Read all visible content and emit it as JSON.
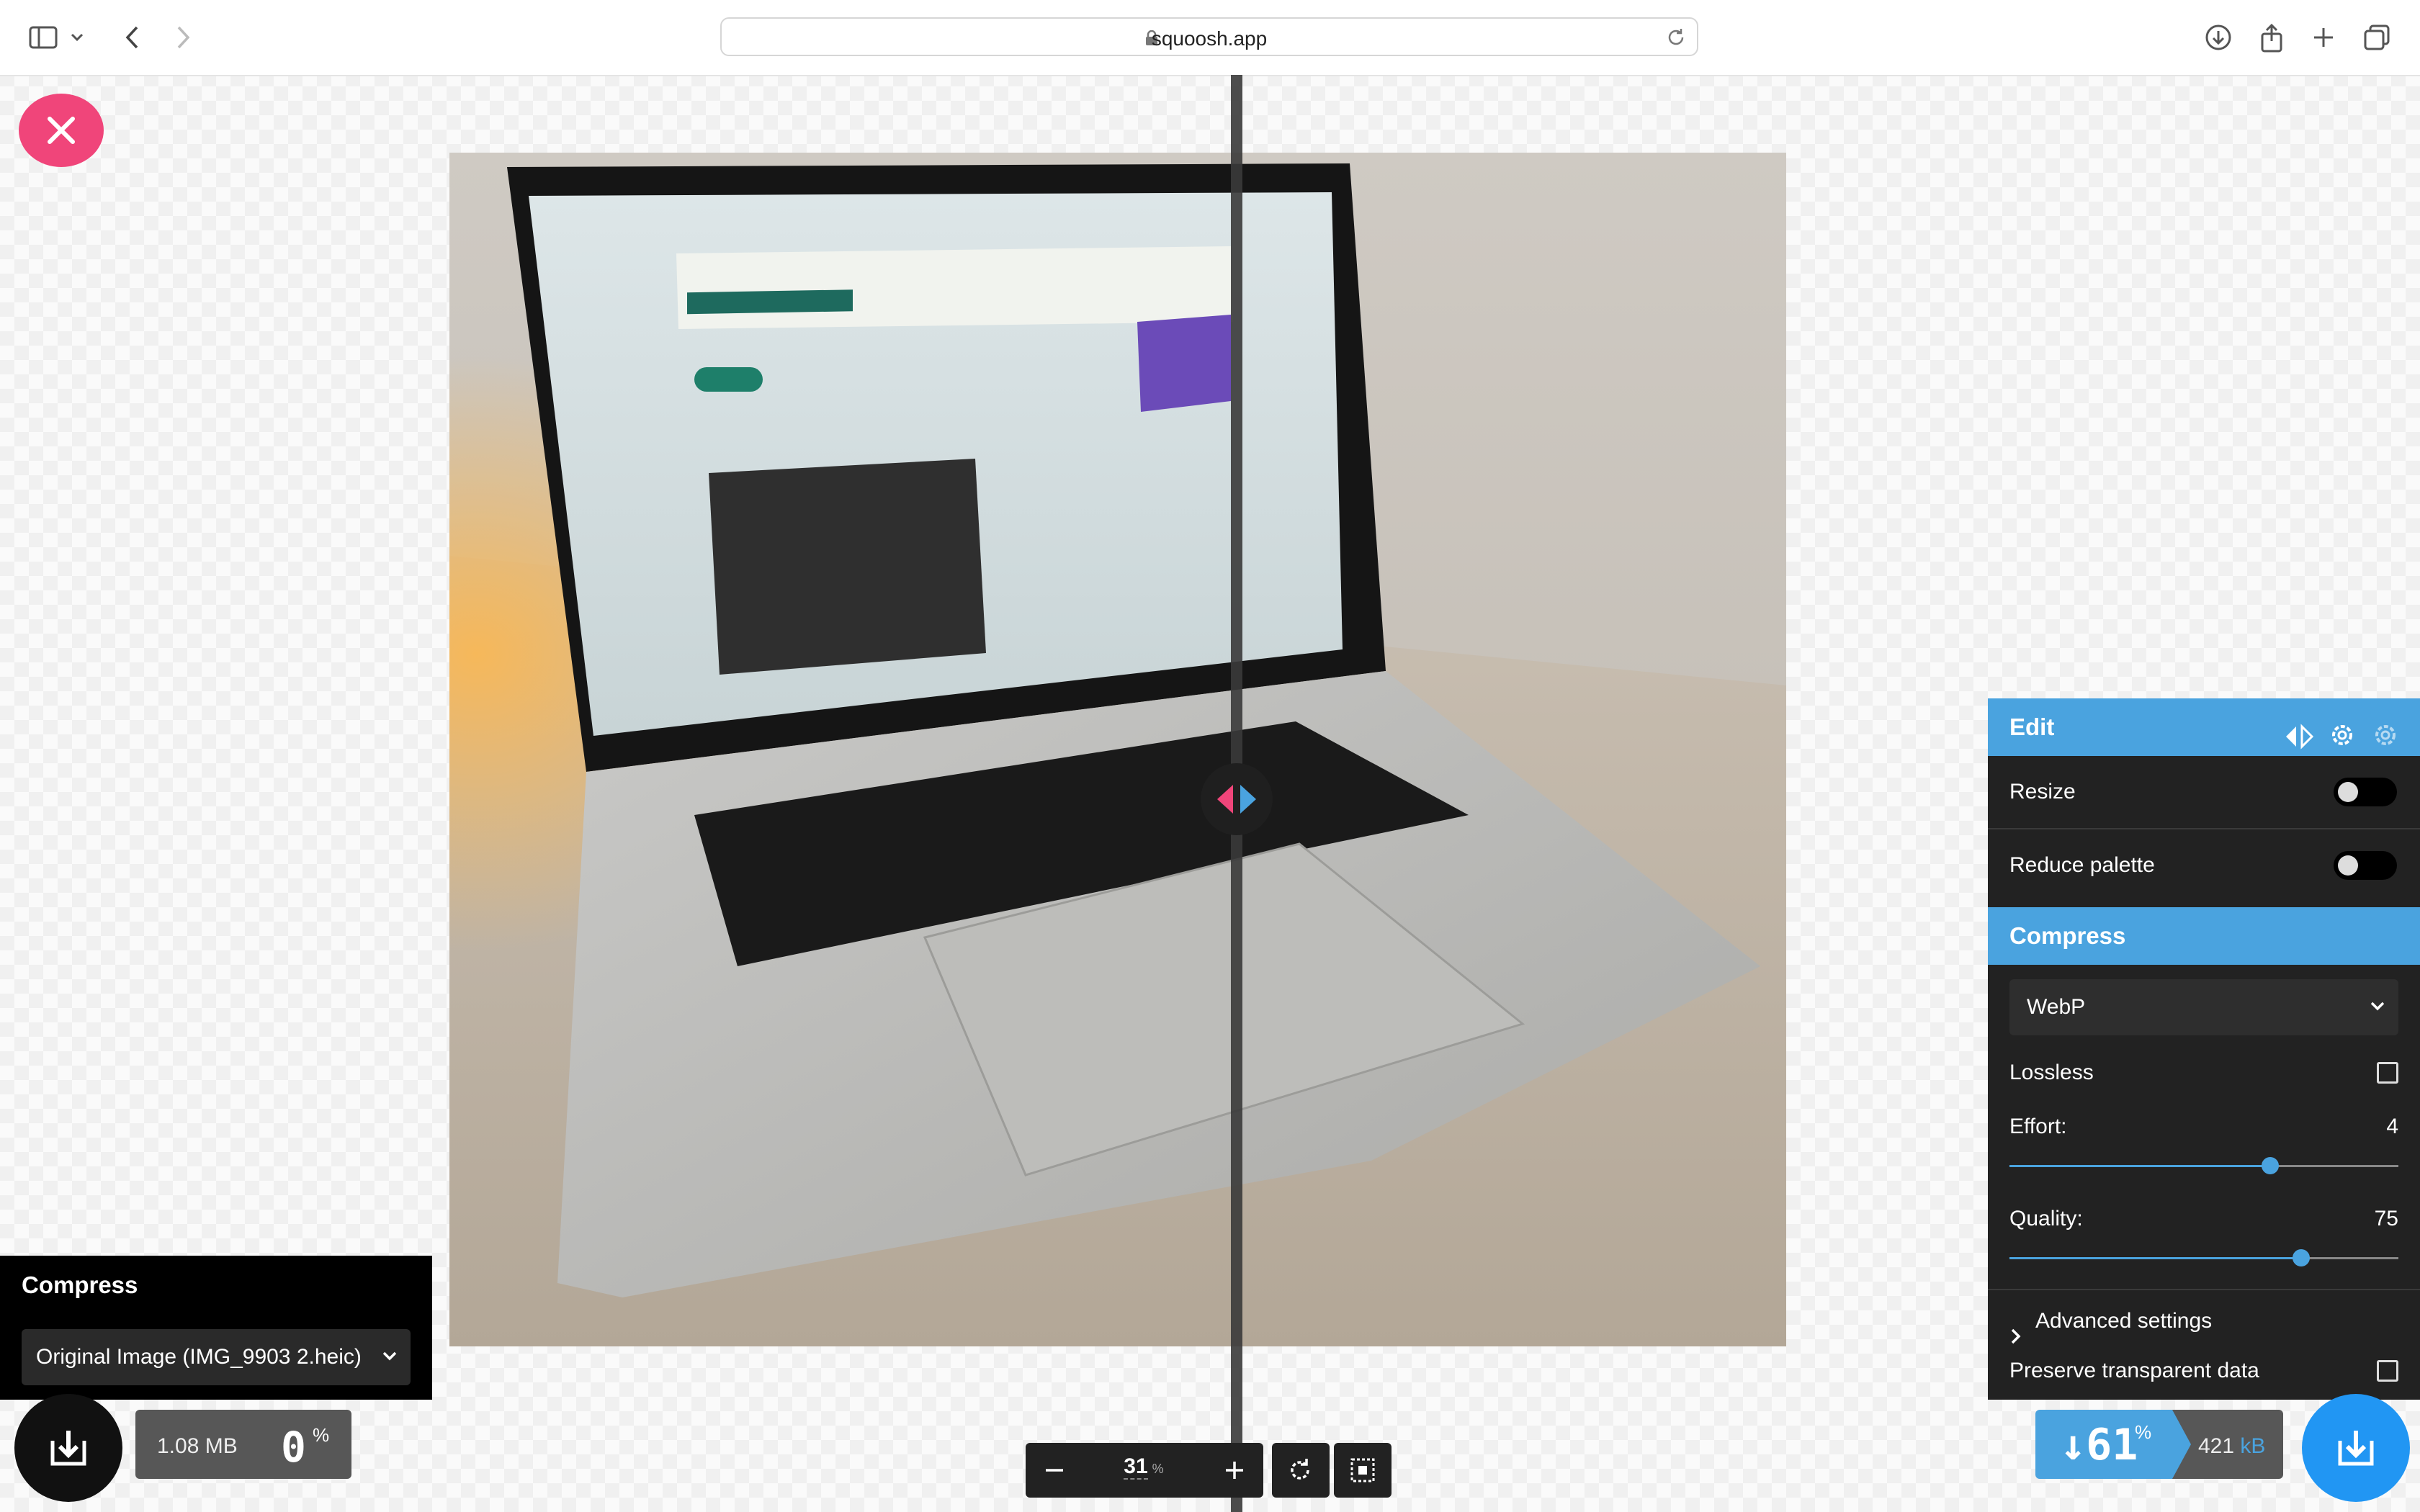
{
  "browser": {
    "url": "squoosh.app"
  },
  "left_panel": {
    "header": "Compress",
    "select_value": "Original Image (IMG_9903 2.heic)",
    "file_size": "1.08 MB",
    "percent": "0",
    "percent_sign": "%"
  },
  "right_panel": {
    "edit_header": "Edit",
    "resize_label": "Resize",
    "reduce_palette_label": "Reduce palette",
    "compress_header": "Compress",
    "codec": "WebP",
    "lossless_label": "Lossless",
    "effort_label": "Effort:",
    "effort_value": "4",
    "effort_fraction": 0.67,
    "quality_label": "Quality:",
    "quality_value": "75",
    "quality_fraction": 0.75,
    "advanced_label": "Advanced settings",
    "preserve_label": "Preserve transparent data",
    "percent": "↓61",
    "percent_sign": "%",
    "file_size": "421",
    "file_size_unit": "kB"
  },
  "zoom": {
    "value": "31",
    "unit": "%"
  },
  "colors": {
    "accent": "#4aa3df",
    "close_button": "#f0457a",
    "panel_bg": "#222222"
  }
}
